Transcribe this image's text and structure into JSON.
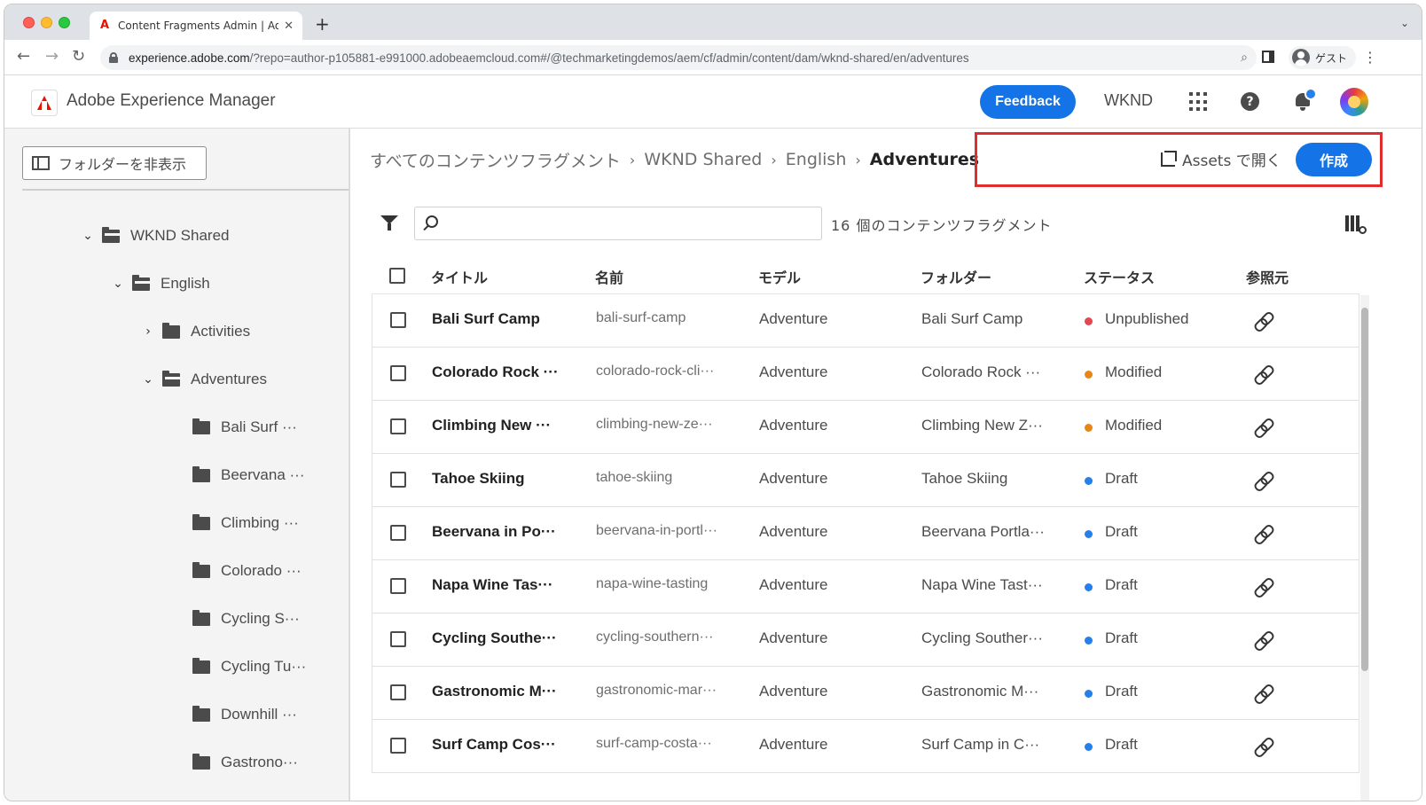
{
  "browser": {
    "tab_title": "Content Fragments Admin | Ad",
    "tab_favicon": "adobe-icon",
    "url_host": "experience.adobe.com",
    "url_path": "/?repo=author-p105881-e991000.adobeaemcloud.com#/@techmarketingdemos/aem/cf/admin/content/dam/wknd-shared/en/adventures",
    "profile_label": "ゲスト"
  },
  "header": {
    "app_title": "Adobe Experience Manager",
    "feedback_label": "Feedback",
    "org_label": "WKND"
  },
  "left_rail": {
    "hide_folders_label": "フォルダーを非表示",
    "tree": [
      {
        "label": "WKND Shared",
        "chevron": "⌄"
      },
      {
        "label": "English",
        "chevron": "⌄"
      },
      {
        "label": "Activities",
        "chevron": "›"
      },
      {
        "label": "Adventures",
        "chevron": "⌄"
      },
      {
        "label": "Bali Surf ···",
        "chevron": ""
      },
      {
        "label": "Beervana ···",
        "chevron": ""
      },
      {
        "label": "Climbing ···",
        "chevron": ""
      },
      {
        "label": "Colorado ···",
        "chevron": ""
      },
      {
        "label": "Cycling S···",
        "chevron": ""
      },
      {
        "label": "Cycling Tu···",
        "chevron": ""
      },
      {
        "label": "Downhill ···",
        "chevron": ""
      },
      {
        "label": "Gastrono···",
        "chevron": ""
      }
    ]
  },
  "main": {
    "breadcrumb": [
      "すべてのコンテンツフラグメント",
      "WKND Shared",
      "English",
      "Adventures"
    ],
    "open_in_assets_label": "Assets で開く",
    "create_label": "作成",
    "search_placeholder": "",
    "result_count": "16 個のコンテンツフラグメント",
    "columns": {
      "title": "タイトル",
      "name": "名前",
      "model": "モデル",
      "folder": "フォルダー",
      "status": "ステータス",
      "referenced_by": "参照元"
    },
    "status_colors": {
      "Unpublished": "#e34850",
      "Modified": "#e68619",
      "Draft": "#2680eb"
    },
    "rows": [
      {
        "title": "Bali Surf Camp",
        "name": "bali-surf-camp",
        "model": "Adventure",
        "folder": "Bali Surf Camp",
        "status": "Unpublished"
      },
      {
        "title": "Colorado Rock ···",
        "name": "colorado-rock-cli···",
        "model": "Adventure",
        "folder": "Colorado Rock ···",
        "status": "Modified"
      },
      {
        "title": "Climbing New ···",
        "name": "climbing-new-ze···",
        "model": "Adventure",
        "folder": "Climbing New Z···",
        "status": "Modified"
      },
      {
        "title": "Tahoe Skiing",
        "name": "tahoe-skiing",
        "model": "Adventure",
        "folder": "Tahoe Skiing",
        "status": "Draft"
      },
      {
        "title": "Beervana in Po···",
        "name": "beervana-in-portl···",
        "model": "Adventure",
        "folder": "Beervana Portla···",
        "status": "Draft"
      },
      {
        "title": "Napa Wine Tas···",
        "name": "napa-wine-tasting",
        "model": "Adventure",
        "folder": "Napa Wine Tast···",
        "status": "Draft"
      },
      {
        "title": "Cycling Southe···",
        "name": "cycling-southern···",
        "model": "Adventure",
        "folder": "Cycling Souther···",
        "status": "Draft"
      },
      {
        "title": "Gastronomic M···",
        "name": "gastronomic-mar···",
        "model": "Adventure",
        "folder": "Gastronomic M···",
        "status": "Draft"
      },
      {
        "title": "Surf Camp Cos···",
        "name": "surf-camp-costa···",
        "model": "Adventure",
        "folder": "Surf Camp in C···",
        "status": "Draft"
      }
    ]
  }
}
